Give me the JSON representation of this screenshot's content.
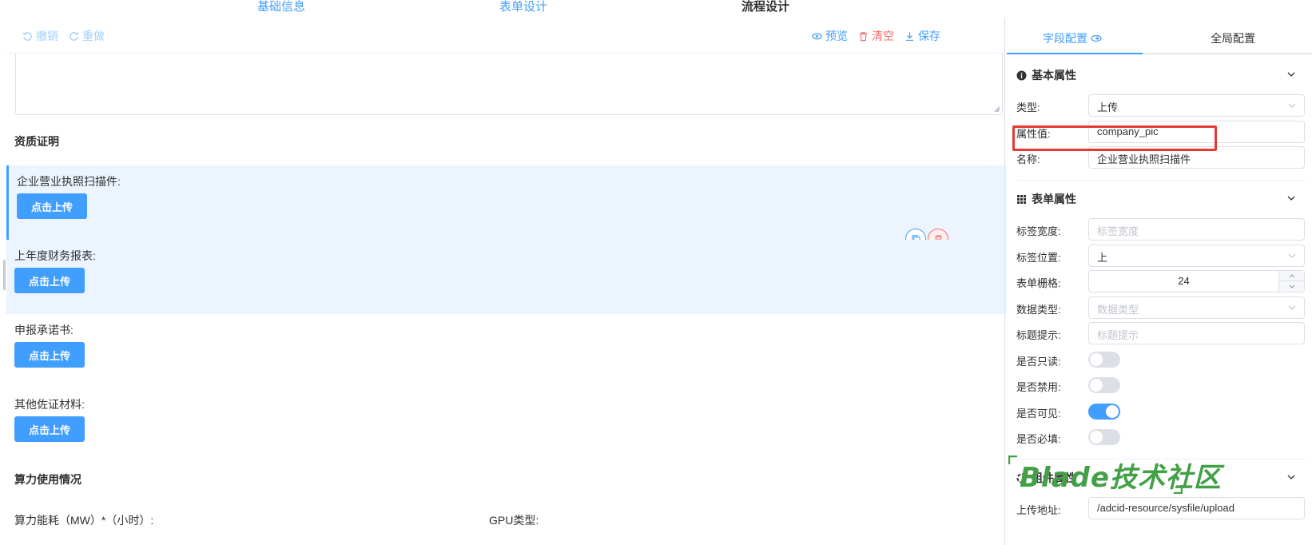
{
  "top_tabs": [
    "基础信息",
    "表单设计",
    "流程设计"
  ],
  "toolbar": {
    "undo": "撤销",
    "redo": "重做",
    "preview": "预览",
    "clear": "清空",
    "save": "保存"
  },
  "canvas": {
    "section1_title": "资质证明",
    "fields": [
      {
        "label": "企业营业执照扫描件:",
        "button": "点击上传"
      },
      {
        "label": "上年度财务报表:",
        "button": "点击上传"
      },
      {
        "label": "申报承诺书:",
        "button": "点击上传"
      },
      {
        "label": "其他佐证材料:",
        "button": "点击上传"
      }
    ],
    "section2_title": "算力使用情况",
    "partial_label_left": "算力能耗（MW）*（小时）:",
    "partial_label_right": "GPU类型:"
  },
  "panel": {
    "tab_field": "字段配置",
    "tab_global": "全局配置",
    "basic": {
      "title": "基本属性",
      "type_label": "类型:",
      "type_value": "上传",
      "prop_label": "属性值:",
      "prop_value": "company_pic",
      "name_label": "名称:",
      "name_value": "企业营业执照扫描件"
    },
    "form": {
      "title": "表单属性",
      "label_width_label": "标签宽度:",
      "label_width_placeholder": "标签宽度",
      "label_pos_label": "标签位置:",
      "label_pos_value": "上",
      "grid_label": "表单栅格:",
      "grid_value": "24",
      "data_type_label": "数据类型:",
      "data_type_placeholder": "数据类型",
      "title_tip_label": "标题提示:",
      "title_tip_placeholder": "标题提示",
      "readonly_label": "是否只读:",
      "readonly": false,
      "disabled_label": "是否禁用:",
      "disabled": false,
      "visible_label": "是否可见:",
      "visible": true,
      "required_label": "是否必填:",
      "required": false
    },
    "component": {
      "title": "组件属性",
      "upload_url_label": "上传地址:",
      "upload_url_value": "/adcid-resource/sysfile/upload"
    }
  },
  "watermark": "Blade技术社区",
  "colors": {
    "primary": "#409eff",
    "danger": "#f56c6c",
    "highlight": "#ecf5ff",
    "annotation": "#e53935",
    "watermark": "#43a047"
  }
}
